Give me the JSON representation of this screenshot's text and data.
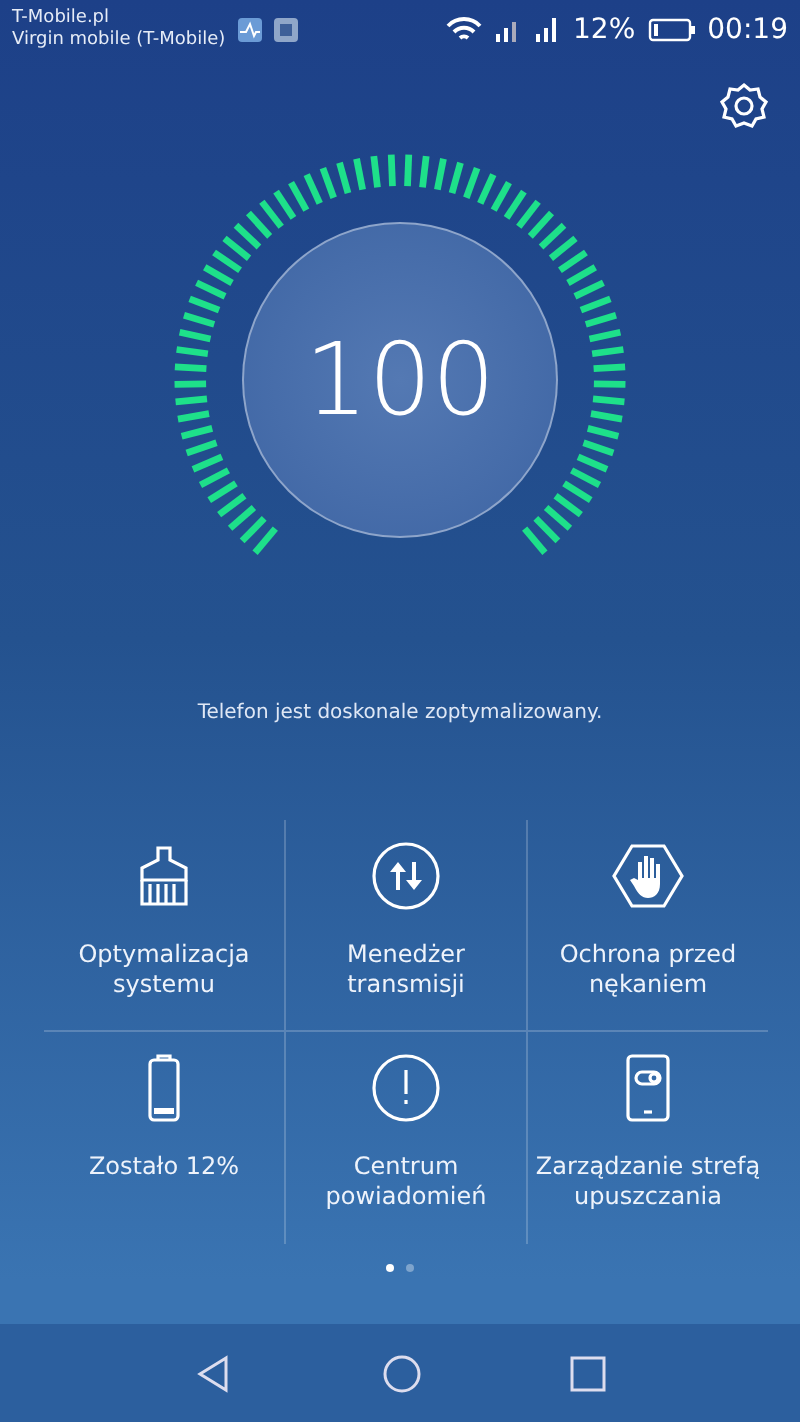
{
  "status_bar": {
    "carrier_1": "T-Mobile.pl",
    "carrier_2": "Virgin mobile (T-Mobile)",
    "battery": "12%",
    "time": "00:19"
  },
  "score": {
    "value": "100",
    "message": "Telefon jest doskonale zoptymalizowany."
  },
  "tiles": [
    {
      "kind": "broom",
      "label": "Optymalizacja systemu"
    },
    {
      "kind": "transfer",
      "label": "Menedżer transmisji"
    },
    {
      "kind": "hand",
      "label": "Ochrona przed nękaniem"
    },
    {
      "kind": "battery",
      "label": "Zostało 12%"
    },
    {
      "kind": "alert",
      "label": "Centrum powiadomień"
    },
    {
      "kind": "toggle",
      "label": "Zarządzanie strefą upuszczania"
    }
  ],
  "pages": [
    {
      "selected": true
    },
    {
      "selected": false
    }
  ]
}
